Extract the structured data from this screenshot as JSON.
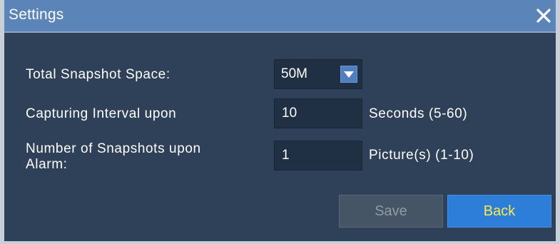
{
  "dialog": {
    "title": "Settings",
    "close_icon": "close-icon"
  },
  "form": {
    "total_space": {
      "label": "Total Snapshot Space:",
      "value": "50M",
      "arrow_icon": "chevron-down-icon"
    },
    "interval": {
      "label": "Capturing Interval upon",
      "value": "10",
      "unit": "Seconds (5-60)"
    },
    "alarm_count": {
      "label_line1": "Number of Snapshots upon",
      "label_line2": "Alarm:",
      "value": "1",
      "unit": "Picture(s) (1-10)"
    }
  },
  "buttons": {
    "save_label": "Save",
    "back_label": "Back"
  },
  "colors": {
    "titlebar": "#5b84b8",
    "body": "#2f4159",
    "back_button": "#2d7ed8",
    "back_text": "#ffe94a"
  }
}
